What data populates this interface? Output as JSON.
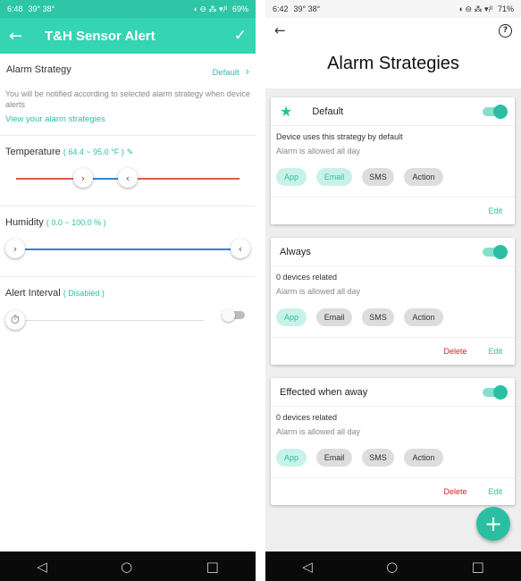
{
  "left": {
    "status": {
      "time": "6:48",
      "temp": "39° 38°",
      "icons": "◖ ⊖ ⁂ ▾ᵢᴵᴵ",
      "battery": "69%"
    },
    "appbar": {
      "back": "←",
      "title": "T&H Sensor Alert",
      "confirm": "✓"
    },
    "alarm_strategy": {
      "label": "Alarm Strategy",
      "value": "Default",
      "chevron": "›"
    },
    "description": "You will be notified according to selected alarm strategy when device alerts",
    "view_link": "View your alarm strategies",
    "temperature": {
      "label": "Temperature",
      "range": "( 64.4 ~ 95.0 °F )",
      "edit_icon": "✎",
      "low_fraction": 0.3,
      "high_fraction": 0.5
    },
    "humidity": {
      "label": "Humidity",
      "range": "( 0.0 ~ 100.0 % )",
      "low_fraction": 0.0,
      "high_fraction": 1.0
    },
    "alert_interval": {
      "label": "Alert Interval",
      "status": "( Disabled )",
      "enabled": false
    }
  },
  "right": {
    "status": {
      "time": "6:42",
      "temp": "39° 38°",
      "icons": "◖ ⊖ ⁂ ▾ᵢᴵᴵ",
      "battery": "71%"
    },
    "appbar": {
      "back": "←",
      "help": "?"
    },
    "title": "Alarm Strategies",
    "cards": [
      {
        "name": "Default",
        "has_star": true,
        "line1": "Device uses this strategy by default",
        "line2": "Alarm is allowed all day",
        "chips": [
          {
            "label": "App",
            "on": true
          },
          {
            "label": "Email",
            "on": true
          },
          {
            "label": "SMS",
            "on": false
          },
          {
            "label": "Action",
            "on": false
          }
        ],
        "delete": "",
        "edit": "Edit"
      },
      {
        "name": "Always",
        "has_star": false,
        "line1": "0 devices related",
        "line2": "Alarm is allowed all day",
        "chips": [
          {
            "label": "App",
            "on": true
          },
          {
            "label": "Email",
            "on": false
          },
          {
            "label": "SMS",
            "on": false
          },
          {
            "label": "Action",
            "on": false
          }
        ],
        "delete": "Delete",
        "edit": "Edit"
      },
      {
        "name": "Effected when away",
        "has_star": false,
        "line1": "0 devices related",
        "line2": "Alarm is allowed all day",
        "chips": [
          {
            "label": "App",
            "on": true
          },
          {
            "label": "Email",
            "on": false
          },
          {
            "label": "SMS",
            "on": false
          },
          {
            "label": "Action",
            "on": false
          }
        ],
        "delete": "Delete",
        "edit": "Edit"
      }
    ],
    "fab": "+"
  },
  "navbar": {
    "back": "◁",
    "home": "○",
    "recents": "□"
  },
  "colors": {
    "accent": "#2bbfa2",
    "appbar": "#35d5b4",
    "temp_track": "#e05a4f",
    "humidity_track": "#2e86d6",
    "delete": "#c62828"
  }
}
